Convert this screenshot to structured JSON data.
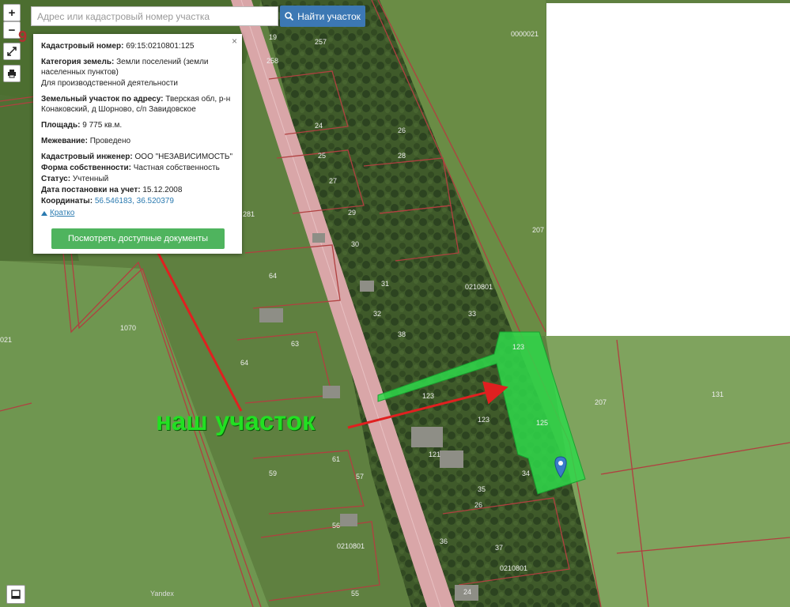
{
  "search": {
    "placeholder": "Адрес или кадастровый номер участка",
    "button_label": "Найти участок"
  },
  "controls": {
    "zoom_in": "+",
    "zoom_out": "−"
  },
  "corner_number": "9",
  "popup": {
    "close": "×",
    "cadastral_label": "Кадастровый номер:",
    "cadastral_value": "69:15:0210801:125",
    "category_label": "Категория земель:",
    "category_value": "Земли поселений (земли населенных пунктов)",
    "use_value": "Для производственной деятельности",
    "address_label": "Земельный участок по адресу:",
    "address_value": "Тверская обл, р-н Конаковский, д Шорново, с/п Завидовское",
    "area_label": "Площадь:",
    "area_value": "9 775 кв.м.",
    "survey_label": "Межевание:",
    "survey_value": "Проведено",
    "engineer_label": "Кадастровый инженер:",
    "engineer_value": "ООО \"НЕЗАВИСИМОСТЬ\"",
    "ownership_label": "Форма собственности:",
    "ownership_value": "Частная собственность",
    "status_label": "Статус:",
    "status_value": "Учтенный",
    "date_label": "Дата постановки на учет:",
    "date_value": "15.12.2008",
    "coords_label": "Координаты:",
    "coords_value": "56.546183, 36.520379",
    "short_link": "Кратко",
    "docs_button": "Посмотреть доступные документы"
  },
  "annotation": "наш участок",
  "watermark": "Yandex",
  "plot_labels": {
    "l1": "19",
    "l2": "257",
    "l3": "258",
    "l4": "24",
    "l5": "25",
    "l6": "26",
    "l7": "27",
    "l8": "28",
    "l9": "29",
    "l10": "30",
    "l11": "31",
    "l12": "32",
    "l13": "33",
    "l14": "38",
    "l15": "281",
    "l16": "1070",
    "l17": "021",
    "l18": "64",
    "l19": "63",
    "l20": "64",
    "l21": "0210801",
    "l22": "123",
    "l23": "123",
    "l24": "123",
    "l25": "125",
    "l26": "121",
    "l27": "34",
    "l28": "35",
    "l29": "207",
    "l30": "207",
    "l31": "131",
    "l32": "0000021",
    "l33": "61",
    "l34": "57",
    "l35": "59",
    "l36": "56",
    "l37": "55",
    "l38": "0210801",
    "l39": "0210801",
    "l40": "36",
    "l41": "37",
    "l42": "26",
    "l43": "24"
  },
  "colors": {
    "highlight": "#2fd84a",
    "arrow": "#e02020",
    "road": "#d9a6a8",
    "boundary": "#b04040"
  }
}
